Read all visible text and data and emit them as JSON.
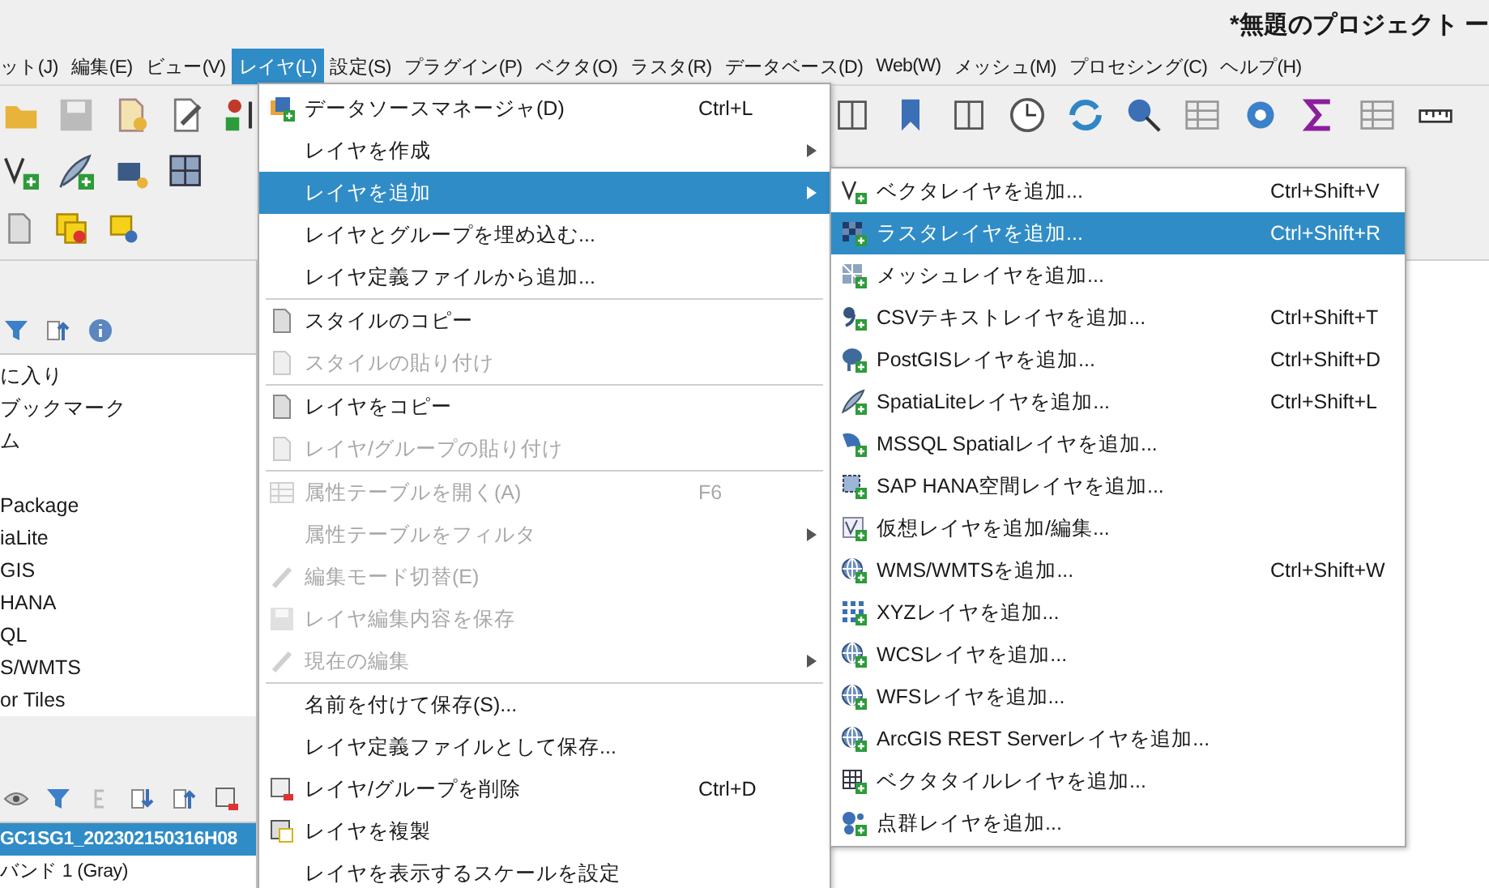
{
  "window": {
    "title": "*無題のプロジェクト ー"
  },
  "menubar": [
    {
      "label": "ット(J)",
      "selected": false
    },
    {
      "label": "編集(E)",
      "selected": false
    },
    {
      "label": "ビュー(V)",
      "selected": false
    },
    {
      "label": "レイヤ(L)",
      "selected": true
    },
    {
      "label": "設定(S)",
      "selected": false
    },
    {
      "label": "プラグイン(P)",
      "selected": false
    },
    {
      "label": "ベクタ(O)",
      "selected": false
    },
    {
      "label": "ラスタ(R)",
      "selected": false
    },
    {
      "label": "データベース(D)",
      "selected": false
    },
    {
      "label": "Web(W)",
      "selected": false
    },
    {
      "label": "メッシュ(M)",
      "selected": false
    },
    {
      "label": "プロセシング(C)",
      "selected": false
    },
    {
      "label": "ヘルプ(H)",
      "selected": false
    }
  ],
  "layer_menu": {
    "items": [
      {
        "kind": "item",
        "label": "データソースマネージャ(D)",
        "shortcut": "Ctrl+L",
        "submenu": false,
        "selected": false,
        "disabled": false
      },
      {
        "kind": "item",
        "label": "レイヤを作成",
        "submenu": true,
        "selected": false,
        "disabled": false
      },
      {
        "kind": "item",
        "label": "レイヤを追加",
        "submenu": true,
        "selected": true,
        "disabled": false
      },
      {
        "kind": "item",
        "label": "レイヤとグループを埋め込む...",
        "submenu": false,
        "selected": false,
        "disabled": false
      },
      {
        "kind": "item",
        "label": "レイヤ定義ファイルから追加...",
        "submenu": false,
        "selected": false,
        "disabled": false
      },
      {
        "kind": "separator"
      },
      {
        "kind": "item",
        "label": "スタイルのコピー",
        "submenu": false,
        "selected": false,
        "disabled": false
      },
      {
        "kind": "item",
        "label": "スタイルの貼り付け",
        "submenu": false,
        "selected": false,
        "disabled": true
      },
      {
        "kind": "separator"
      },
      {
        "kind": "item",
        "label": "レイヤをコピー",
        "submenu": false,
        "selected": false,
        "disabled": false
      },
      {
        "kind": "item",
        "label": "レイヤ/グループの貼り付け",
        "submenu": false,
        "selected": false,
        "disabled": true
      },
      {
        "kind": "separator"
      },
      {
        "kind": "item",
        "label": "属性テーブルを開く(A)",
        "shortcut": "F6",
        "submenu": false,
        "selected": false,
        "disabled": true
      },
      {
        "kind": "item",
        "label": "属性テーブルをフィルタ",
        "submenu": true,
        "selected": false,
        "disabled": true
      },
      {
        "kind": "item",
        "label": "編集モード切替(E)",
        "submenu": false,
        "selected": false,
        "disabled": true
      },
      {
        "kind": "item",
        "label": "レイヤ編集内容を保存",
        "submenu": false,
        "selected": false,
        "disabled": true
      },
      {
        "kind": "item",
        "label": "現在の編集",
        "submenu": true,
        "selected": false,
        "disabled": true
      },
      {
        "kind": "separator"
      },
      {
        "kind": "item",
        "label": "名前を付けて保存(S)...",
        "submenu": false,
        "selected": false,
        "disabled": false
      },
      {
        "kind": "item",
        "label": "レイヤ定義ファイルとして保存...",
        "submenu": false,
        "selected": false,
        "disabled": false
      },
      {
        "kind": "item",
        "label": "レイヤ/グループを削除",
        "shortcut": "Ctrl+D",
        "submenu": false,
        "selected": false,
        "disabled": false
      },
      {
        "kind": "item",
        "label": "レイヤを複製",
        "submenu": false,
        "selected": false,
        "disabled": false
      },
      {
        "kind": "item",
        "label": "レイヤを表示するスケールを設定",
        "submenu": false,
        "selected": false,
        "disabled": false
      }
    ]
  },
  "add_layer_submenu": {
    "items": [
      {
        "label": "ベクタレイヤを追加...",
        "shortcut": "Ctrl+Shift+V",
        "selected": false
      },
      {
        "label": "ラスタレイヤを追加...",
        "shortcut": "Ctrl+Shift+R",
        "selected": true
      },
      {
        "label": "メッシュレイヤを追加...",
        "selected": false
      },
      {
        "label": "CSVテキストレイヤを追加...",
        "shortcut": "Ctrl+Shift+T",
        "selected": false
      },
      {
        "label": "PostGISレイヤを追加...",
        "shortcut": "Ctrl+Shift+D",
        "selected": false
      },
      {
        "label": "SpatiaLiteレイヤを追加...",
        "shortcut": "Ctrl+Shift+L",
        "selected": false
      },
      {
        "label": "MSSQL Spatialレイヤを追加...",
        "selected": false
      },
      {
        "label": "SAP HANA空間レイヤを追加...",
        "selected": false
      },
      {
        "label": "仮想レイヤを追加/編集...",
        "selected": false
      },
      {
        "label": "WMS/WMTSを追加...",
        "shortcut": "Ctrl+Shift+W",
        "selected": false
      },
      {
        "label": "XYZレイヤを追加...",
        "selected": false
      },
      {
        "label": "WCSレイヤを追加...",
        "selected": false
      },
      {
        "label": "WFSレイヤを追加...",
        "selected": false
      },
      {
        "label": "ArcGIS REST Serverレイヤを追加...",
        "selected": false
      },
      {
        "label": "ベクタタイルレイヤを追加...",
        "selected": false
      },
      {
        "label": "点群レイヤを追加...",
        "selected": false
      }
    ]
  },
  "browser_panel": {
    "items": [
      "に入り",
      "ブックマーク",
      "ム",
      "Package",
      "iaLite",
      "GIS",
      "HANA",
      "QL",
      "S/WMTS",
      "or Tiles"
    ]
  },
  "layers_panel": {
    "layers": [
      {
        "label": "GC1SG1_202302150316H08",
        "selected": true
      },
      {
        "label": "バンド 1 (Gray)",
        "selected": false
      }
    ]
  }
}
